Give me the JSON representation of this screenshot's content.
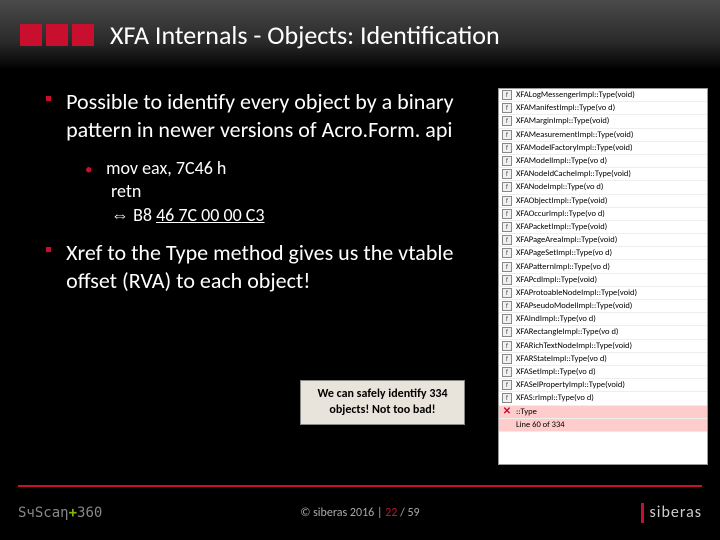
{
  "title": "XFA Internals - Objects: Identification",
  "bullets": [
    {
      "text": "Possible to identify every object by a binary pattern in newer versions of Acro.Form. api"
    },
    {
      "text": "Xref to the Type method gives us the vtable offset (RVA) to each object!"
    }
  ],
  "sub": {
    "line1": "mov eax, 7C46 h",
    "line2": "retn",
    "line3_prefix": "⇔  B8 ",
    "line3_u1": "46 7C 00 00",
    "line3_u2": " C3"
  },
  "callout": "We can safely identify 334 objects! Not too bad!",
  "functions": [
    "XFALogMessengerImpl::Type(void)",
    "XFAManifestImpl::Type(vo d)",
    "XFAMarginImpl::Type(void)",
    "XFAMeasurementImpl::Type(void)",
    "XFAModelFactoryImpl::Type(void)",
    "XFAModelImpl::Type(vo d)",
    "XFANodeIdCacheImpl::Type(void)",
    "XFANodeImpl::Type(vo d)",
    "XFAObjectImpl::Type(void)",
    "XFAOccurImpl::Type(vo d)",
    "XFAPacketImpl::Type(void)",
    "XFAPageAreaImpl::Type(void)",
    "XFAPageSetImpl::Type(vo d)",
    "XFAPatternImpl::Type(vo d)",
    "XFAPcdImpl::Type(void)",
    "XFAProtoableNodeImpl::Type(void)",
    "XFAPseudoModelImpl::Type(void)",
    "XFAIndImpl::Type(vo d)",
    "XFARectangleImpl::Type(vo d)",
    "XFARichTextNodeImpl::Type(void)",
    "XFARStateImpl::Type(vo d)",
    "XFASetImpl::Type(vo d)",
    "XFASelPropertyImpl::Type(void)",
    "XFAS:rImpl::Type(vo d)"
  ],
  "search_label": "::Type",
  "search_line": "Line 60 of 334",
  "footer": {
    "logo_left": "SчScaη",
    "logo_plus": "+",
    "logo_360": "360",
    "copyright": "© siberas 2016   |   ",
    "page": "22",
    "total": " / 59",
    "logo_right": "siberas"
  }
}
